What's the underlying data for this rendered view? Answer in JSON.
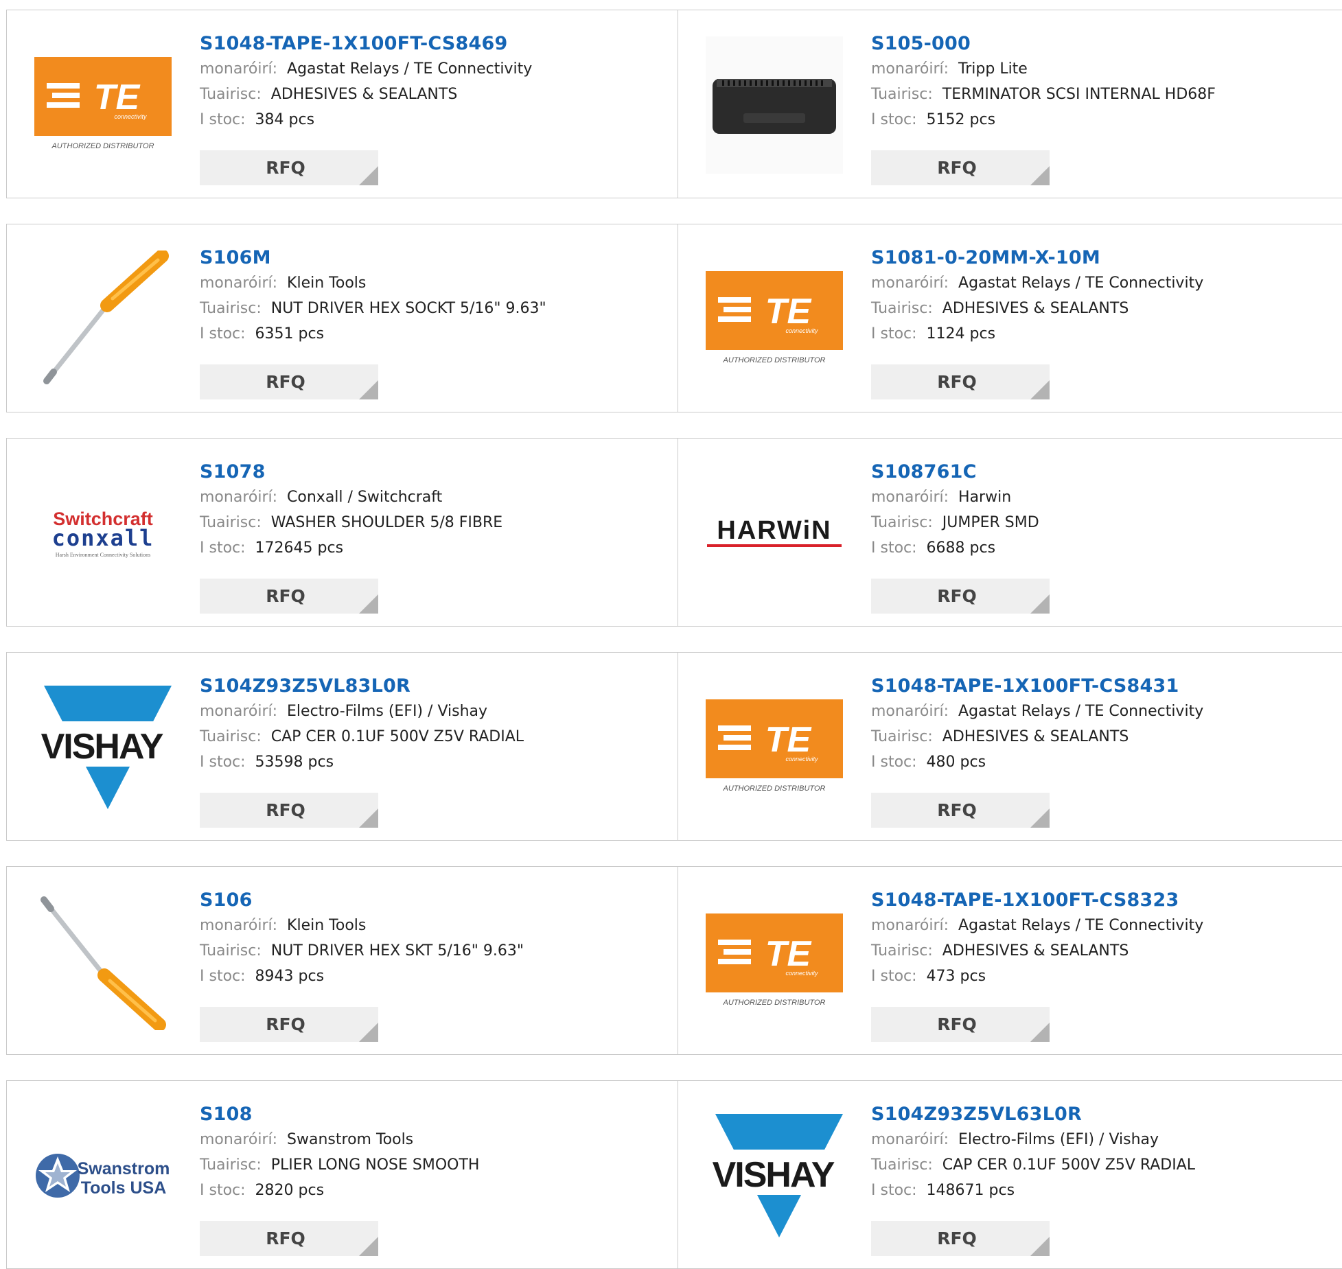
{
  "labels": {
    "manufacturer": "monaróirí:",
    "description": "Tuairisc:",
    "stock": "I stoc:",
    "rfq": "RFQ"
  },
  "products": [
    {
      "part": "S1048-TAPE-1X100FT-CS8469",
      "manufacturer": "Agastat Relays / TE Connectivity",
      "description": "ADHESIVES & SEALANTS",
      "stock": "384 pcs",
      "logo": "te-connectivity-logo"
    },
    {
      "part": "S105-000",
      "manufacturer": "Tripp Lite",
      "description": "TERMINATOR SCSI INTERNAL HD68F",
      "stock": "5152 pcs",
      "logo": "scsi-terminator-photo"
    },
    {
      "part": "S106M",
      "manufacturer": "Klein Tools",
      "description": "NUT DRIVER HEX SOCKT 5/16\" 9.63\"",
      "stock": "6351 pcs",
      "logo": "nut-driver-photo"
    },
    {
      "part": "S1081-0-20MM-X-10M",
      "manufacturer": "Agastat Relays / TE Connectivity",
      "description": "ADHESIVES & SEALANTS",
      "stock": "1124 pcs",
      "logo": "te-connectivity-logo"
    },
    {
      "part": "S1078",
      "manufacturer": "Conxall / Switchcraft",
      "description": "WASHER SHOULDER 5/8 FIBRE",
      "stock": "172645 pcs",
      "logo": "switchcraft-conxall-logo"
    },
    {
      "part": "S108761C",
      "manufacturer": "Harwin",
      "description": "JUMPER SMD",
      "stock": "6688 pcs",
      "logo": "harwin-logo"
    },
    {
      "part": "S104Z93Z5VL83L0R",
      "manufacturer": "Electro-Films (EFI) / Vishay",
      "description": "CAP CER 0.1UF 500V Z5V RADIAL",
      "stock": "53598 pcs",
      "logo": "vishay-logo"
    },
    {
      "part": "S1048-TAPE-1X100FT-CS8431",
      "manufacturer": "Agastat Relays / TE Connectivity",
      "description": "ADHESIVES & SEALANTS",
      "stock": "480 pcs",
      "logo": "te-connectivity-logo"
    },
    {
      "part": "S106",
      "manufacturer": "Klein Tools",
      "description": "NUT DRIVER HEX SKT 5/16\" 9.63\"",
      "stock": "8943 pcs",
      "logo": "nut-driver-photo"
    },
    {
      "part": "S1048-TAPE-1X100FT-CS8323",
      "manufacturer": "Agastat Relays / TE Connectivity",
      "description": "ADHESIVES & SEALANTS",
      "stock": "473 pcs",
      "logo": "te-connectivity-logo"
    },
    {
      "part": "S108",
      "manufacturer": "Swanstrom Tools",
      "description": "PLIER LONG NOSE SMOOTH",
      "stock": "2820 pcs",
      "logo": "swanstrom-tools-logo"
    },
    {
      "part": "S104Z93Z5VL63L0R",
      "manufacturer": "Electro-Films (EFI) / Vishay",
      "description": "CAP CER 0.1UF 500V Z5V RADIAL",
      "stock": "148671 pcs",
      "logo": "vishay-logo"
    }
  ],
  "logo_text": {
    "te_brand": "TE",
    "te_sub": "connectivity",
    "te_tag": "AUTHORIZED DISTRIBUTOR",
    "switchcraft": "Switchcraft",
    "conxall": "conxall",
    "conxall_tag": "Harsh Environment Connectivity Solutions",
    "harwin": "HARWiN",
    "vishay": "VISHAY",
    "swanstrom_1": "Swanstrom",
    "swanstrom_2": "Tools USA"
  },
  "colors": {
    "part_link": "#1565b5",
    "te_orange": "#f28b1e",
    "vishay_blue": "#1c8fd0",
    "harwin_red": "#d9212a"
  }
}
